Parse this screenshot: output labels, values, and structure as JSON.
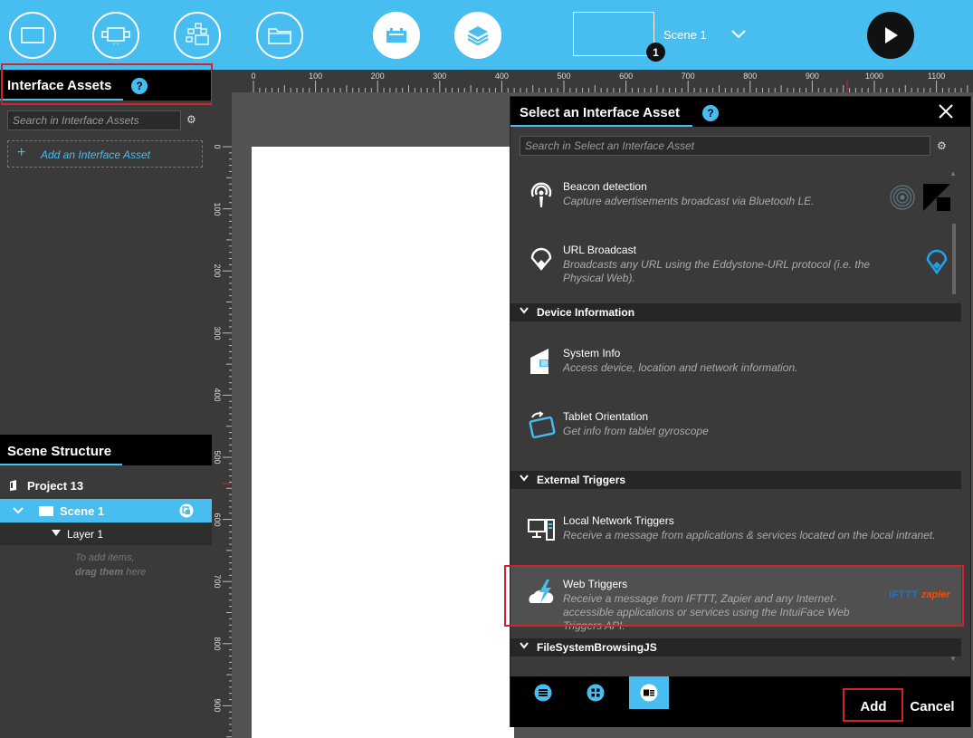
{
  "topbar": {
    "buttons": [
      {
        "icon": "rectangle-icon"
      },
      {
        "icon": "component-icon"
      },
      {
        "icon": "network-icon"
      },
      {
        "icon": "folder-icon"
      },
      {
        "icon": "interface-assets-icon"
      },
      {
        "icon": "layers-icon"
      }
    ],
    "scene_name": "Scene 1",
    "scene_badge": "1",
    "play_icon": "play-icon",
    "accent_color": "#48bdf0"
  },
  "interface_assets": {
    "title": "Interface Assets",
    "help": "?",
    "search_placeholder": "Search in Interface Assets",
    "add_label": "Add an Interface Asset",
    "add_symbol": "+"
  },
  "scene_structure": {
    "title": "Scene Structure",
    "project": "Project 13",
    "scene": "Scene 1",
    "layer": "Layer 1",
    "hint_line1": "To add items,",
    "hint_bold": "drag them",
    "hint_after": " here"
  },
  "ruler": {
    "top_labels": [
      "0",
      "100",
      "200",
      "300",
      "400",
      "500",
      "600",
      "700",
      "800",
      "900",
      "1000",
      "1100"
    ],
    "left_labels": [
      "0",
      "100",
      "200",
      "300",
      "400",
      "500",
      "600",
      "700",
      "800",
      "900"
    ]
  },
  "dialog": {
    "title": "Select an Interface Asset",
    "help": "?",
    "search_placeholder": "Search in Select an Interface Asset",
    "items_top": [
      {
        "name": "Beacon detection",
        "desc": "Capture advertisements broadcast via Bluetooth LE."
      },
      {
        "name": "URL Broadcast",
        "desc": "Broadcasts any URL using the Eddystone-URL protocol (i.e. the Physical Web)."
      }
    ],
    "cat_device": "Device Information",
    "items_device": [
      {
        "name": "System Info",
        "desc": "Access device, location and network information."
      },
      {
        "name": "Tablet Orientation",
        "desc": "Get info from tablet gyroscope"
      }
    ],
    "cat_external": "External Triggers",
    "items_external": [
      {
        "name": "Local Network Triggers",
        "desc": "Receive a message from applications & services located on the local intranet."
      },
      {
        "name": "Web Triggers",
        "desc": "Receive a message from IFTTT, Zapier and any Internet-accessible applications or services using the IntuiFace Web Triggers API."
      }
    ],
    "brand_ifttt": "IFTTT",
    "brand_zapier": "zapier",
    "cat_fs": "FileSystemBrowsingJS",
    "add_label": "Add",
    "cancel_label": "Cancel"
  }
}
